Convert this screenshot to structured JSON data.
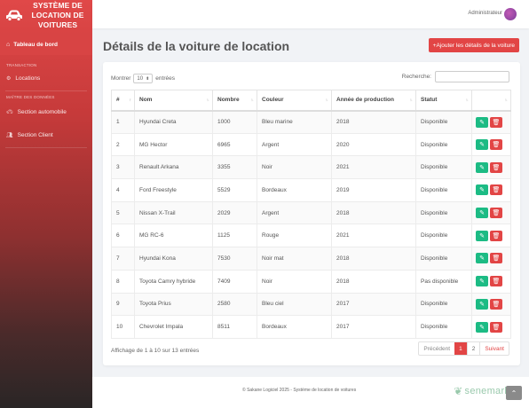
{
  "brand": {
    "title": "SYSTÈME DE LOCATION DE VOITURES",
    "icon": "car-icon"
  },
  "sidebar": {
    "active": {
      "label": "Tableau de bord",
      "icon": "home-icon"
    },
    "sections": [
      {
        "heading": "TRANSACTION",
        "items": [
          {
            "label": "Locations",
            "icon": "gear-icon"
          }
        ]
      },
      {
        "heading": "MAÎTRE DES DONNÉES",
        "items": [
          {
            "label": "Section automobile",
            "icon": "car-icon"
          },
          {
            "label": "Section Client",
            "icon": "users-icon"
          }
        ]
      }
    ]
  },
  "topbar": {
    "user": "Administrateur"
  },
  "header": {
    "title": "Détails de la voiture de location",
    "add_button": "+Ajouter les détails de la voiture"
  },
  "table_controls": {
    "show_before": "Montrer",
    "show_value": "10",
    "show_after": "entrées",
    "search_label": "Recherche:"
  },
  "table": {
    "columns": [
      "#",
      "Nom",
      "Nombre",
      "Couleur",
      "Année de production",
      "Statut",
      ""
    ],
    "rows": [
      [
        "1",
        "Hyundai Creta",
        "1000",
        "Bleu marine",
        "2018",
        "Disponible"
      ],
      [
        "2",
        "MG Hector",
        "6965",
        "Argent",
        "2020",
        "Disponible"
      ],
      [
        "3",
        "Renault Arkana",
        "3355",
        "Noir",
        "2021",
        "Disponible"
      ],
      [
        "4",
        "Ford Freestyle",
        "5529",
        "Bordeaux",
        "2019",
        "Disponible"
      ],
      [
        "5",
        "Nissan X-Trail",
        "2029",
        "Argent",
        "2018",
        "Disponible"
      ],
      [
        "6",
        "MG RC-6",
        "1125",
        "Rouge",
        "2021",
        "Disponible"
      ],
      [
        "7",
        "Hyundai Kona",
        "7530",
        "Noir mat",
        "2018",
        "Disponible"
      ],
      [
        "8",
        "Toyota Camry hybride",
        "7409",
        "Noir",
        "2018",
        "Pas disponible"
      ],
      [
        "9",
        "Toyota Prius",
        "2580",
        "Bleu ciel",
        "2017",
        "Disponible"
      ],
      [
        "10",
        "Chevrolet Impala",
        "8511",
        "Bordeaux",
        "2017",
        "Disponible"
      ]
    ]
  },
  "pagination": {
    "info": "Affichage de 1 à 10 sur 13 entrées",
    "prev": "Précédent",
    "pages": [
      "1",
      "2"
    ],
    "next": "Suivant"
  },
  "footer": {
    "text": "© Sakane Logiciel 2025 - Système de location de voitures",
    "watermark": "senemarket"
  },
  "colors": {
    "accent": "#e24545",
    "edit": "#1cbb84"
  }
}
